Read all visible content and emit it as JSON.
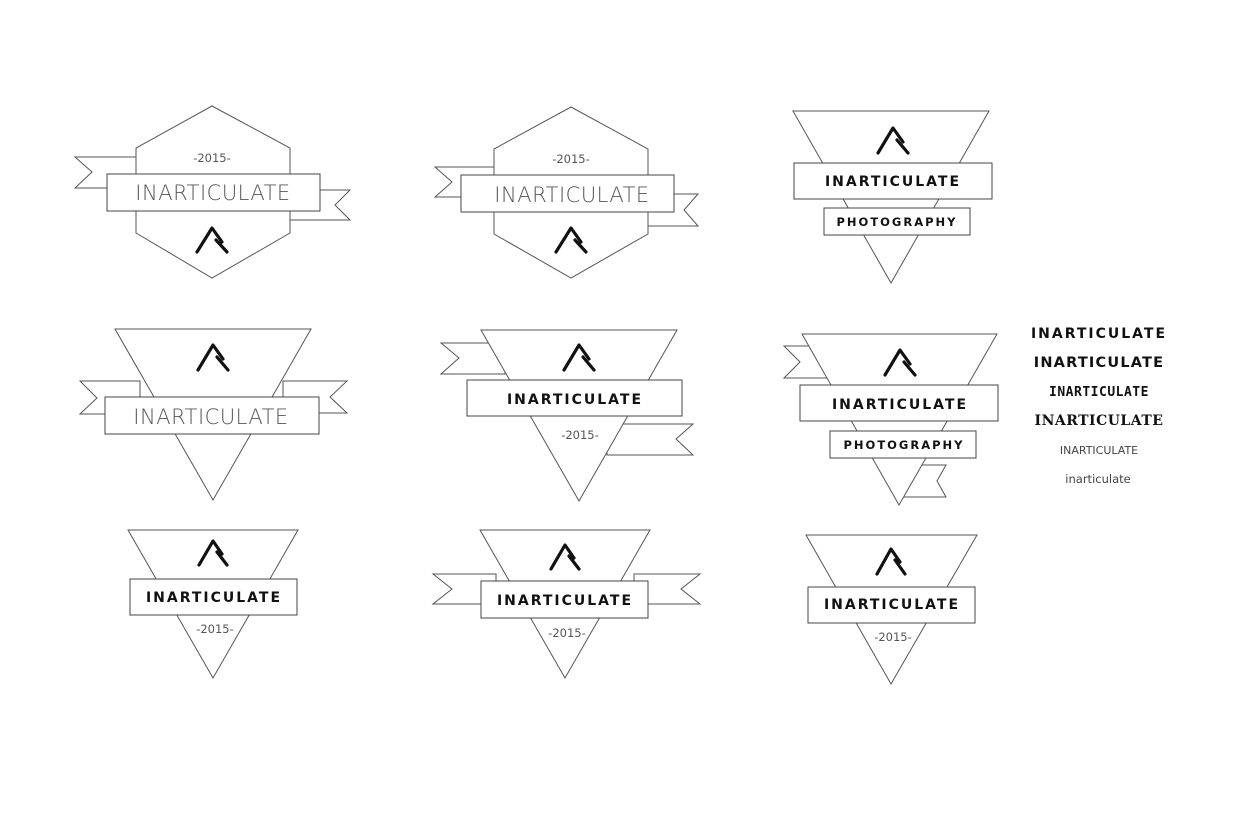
{
  "badges": {
    "year": "-2015-",
    "brand": "INARTICULATE",
    "subtitle": "PHOTOGRAPHY",
    "logo_mark": "lambda-mountain-icon"
  },
  "font_samples": [
    "INARTICULATE",
    "INARTICULATE",
    "INARTICULATE",
    "INARTICULATE",
    "INARTICULATE",
    "inarticulate"
  ],
  "colors": {
    "background": "#ffffff",
    "outline": "#555555",
    "ink": "#111111"
  }
}
